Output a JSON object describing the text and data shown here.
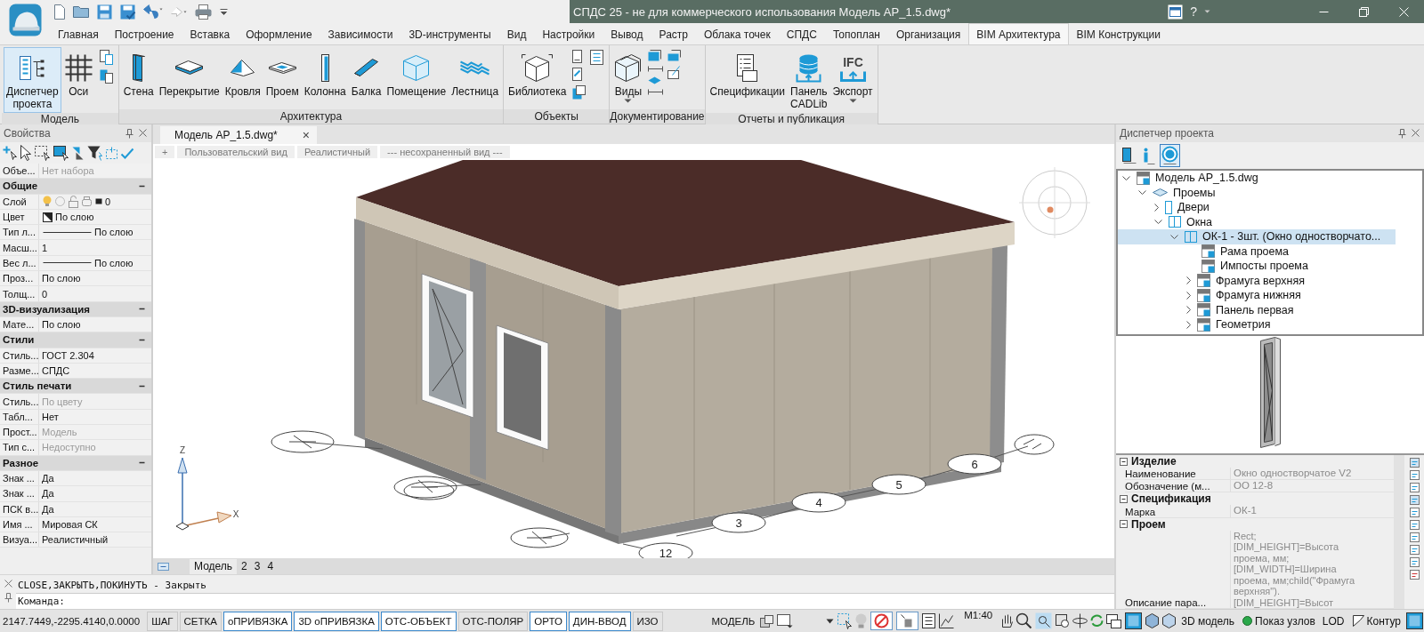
{
  "title_bar": {
    "title": "СПДС 25 - не для коммерческого использования Модель АР_1.5.dwg*",
    "help": "?"
  },
  "menu_tabs": [
    {
      "label": "Главная",
      "selected": false
    },
    {
      "label": "Построение",
      "selected": false
    },
    {
      "label": "Вставка",
      "selected": false
    },
    {
      "label": "Оформление",
      "selected": false
    },
    {
      "label": "Зависимости",
      "selected": false
    },
    {
      "label": "3D-инструменты",
      "selected": false
    },
    {
      "label": "Вид",
      "selected": false
    },
    {
      "label": "Настройки",
      "selected": false
    },
    {
      "label": "Вывод",
      "selected": false
    },
    {
      "label": "Растр",
      "selected": false
    },
    {
      "label": "Облака точек",
      "selected": false
    },
    {
      "label": "СПДС",
      "selected": false
    },
    {
      "label": "Топоплан",
      "selected": false
    },
    {
      "label": "Организация",
      "selected": false
    },
    {
      "label": "BIM Архитектура",
      "selected": true
    },
    {
      "label": "BIM Конструкции",
      "selected": false
    }
  ],
  "ribbon": {
    "groups": [
      {
        "label": "Модель",
        "buttons": [
          {
            "label": "Диспетчер проекта",
            "selected": true
          },
          {
            "label": "Оси",
            "selected": false
          }
        ]
      },
      {
        "label": "Архитектура",
        "buttons": [
          {
            "label": "Стена",
            "selected": false
          },
          {
            "label": "Перекрытие",
            "selected": false
          },
          {
            "label": "Кровля",
            "selected": false
          },
          {
            "label": "Проем",
            "selected": false
          },
          {
            "label": "Колонна",
            "selected": false
          },
          {
            "label": "Балка",
            "selected": false
          },
          {
            "label": "Помещение",
            "selected": false
          },
          {
            "label": "Лестница",
            "selected": false
          }
        ]
      },
      {
        "label": "Объекты",
        "buttons": [
          {
            "label": "Библиотека",
            "selected": false
          }
        ]
      },
      {
        "label": "Документирование",
        "buttons": [
          {
            "label": "Виды",
            "selected": false
          }
        ]
      },
      {
        "label": "Отчеты и публикация",
        "buttons": [
          {
            "label": "Спецификации",
            "selected": false
          },
          {
            "label": "Панель CADLib",
            "selected": false
          },
          {
            "label": "Экспорт",
            "selected": false,
            "icon_text": "IFC"
          }
        ]
      }
    ]
  },
  "properties_panel": {
    "title": "Свойства",
    "rows": [
      {
        "kind": "row",
        "label": "Объе...",
        "value": "Нет набора",
        "disabled": true
      },
      {
        "kind": "category",
        "label": "Общие",
        "expanded": true
      },
      {
        "kind": "layer",
        "label": "Слой",
        "value": "0",
        "disabled": false
      },
      {
        "kind": "color",
        "label": "Цвет",
        "value": "По слою",
        "disabled": false
      },
      {
        "kind": "line",
        "label": "Тип л...",
        "value": "По слою",
        "disabled": false
      },
      {
        "kind": "row",
        "label": "Масш...",
        "value": "1",
        "disabled": false
      },
      {
        "kind": "line",
        "label": "Вес л...",
        "value": "По слою",
        "disabled": false
      },
      {
        "kind": "row",
        "label": "Проз...",
        "value": "По слою",
        "disabled": false
      },
      {
        "kind": "row",
        "label": "Толщ...",
        "value": "0",
        "disabled": false
      },
      {
        "kind": "category",
        "label": "3D-визуализация",
        "expanded": true
      },
      {
        "kind": "row",
        "label": "Мате...",
        "value": "По слою",
        "disabled": false
      },
      {
        "kind": "category",
        "label": "Стили",
        "expanded": true
      },
      {
        "kind": "row",
        "label": "Стиль...",
        "value": "ГОСТ 2.304",
        "disabled": false
      },
      {
        "kind": "row",
        "label": "Разме...",
        "value": "СПДС",
        "disabled": false
      },
      {
        "kind": "category",
        "label": "Стиль печати",
        "expanded": true
      },
      {
        "kind": "row",
        "label": "Стиль...",
        "value": "По цвету",
        "disabled": true
      },
      {
        "kind": "row",
        "label": "Табл...",
        "value": "Нет",
        "disabled": false
      },
      {
        "kind": "row",
        "label": "Прост...",
        "value": "Модель",
        "disabled": true
      },
      {
        "kind": "row",
        "label": "Тип с...",
        "value": "Недоступно",
        "disabled": true
      },
      {
        "kind": "category",
        "label": "Разное",
        "expanded": true
      },
      {
        "kind": "row",
        "label": "Знак ...",
        "value": "Да",
        "disabled": false
      },
      {
        "kind": "row",
        "label": "Знак ...",
        "value": "Да",
        "disabled": false
      },
      {
        "kind": "row",
        "label": "ПСК в...",
        "value": "Да",
        "disabled": false
      },
      {
        "kind": "row",
        "label": "Имя ...",
        "value": "Мировая СК",
        "disabled": false
      },
      {
        "kind": "row",
        "label": "Визуа...",
        "value": "Реалистичный",
        "disabled": false
      }
    ]
  },
  "viewport": {
    "document_tab": {
      "label": "Модель АР_1.5.dwg*",
      "close": "×"
    },
    "view_controls": [
      "+",
      "Пользовательский вид",
      "Реалистичный",
      "--- несохраненный вид ---"
    ],
    "axis_labels": {
      "z": "Z",
      "x": "X"
    },
    "grid_marks": [
      "12",
      "3",
      "4",
      "5",
      "6"
    ],
    "layout_tabs": [
      {
        "label": "Модель",
        "selected": true
      },
      {
        "label": "2",
        "selected": false
      },
      {
        "label": "3",
        "selected": false
      },
      {
        "label": "4",
        "selected": false
      }
    ]
  },
  "command_line": {
    "history": "CLOSE,ЗАКРЫТЬ,ПОКИНУТЬ - Закрыть",
    "prompt": "Команда:"
  },
  "project_manager": {
    "title": "Диспетчер проекта",
    "view_buttons": [
      {
        "selected": false
      },
      {
        "selected": false
      },
      {
        "selected": true
      }
    ],
    "tree": [
      {
        "label": "Модель АР_1.5.dwg",
        "kind": "dwg",
        "expanded": true,
        "selected": false,
        "children": [
          {
            "label": "Проемы",
            "kind": "group",
            "expanded": true,
            "selected": false,
            "children": [
              {
                "label": "Двери",
                "kind": "door",
                "expanded": false,
                "selected": false
              },
              {
                "label": "Окна",
                "kind": "window",
                "expanded": true,
                "selected": false,
                "children": [
                  {
                    "label": "ОК-1 - 3шт. (Окно одностворчато...",
                    "kind": "window",
                    "expanded": true,
                    "selected": true,
                    "children": [
                      {
                        "label": "Рама проема",
                        "kind": "dwg",
                        "selected": false
                      },
                      {
                        "label": "Импосты проема",
                        "kind": "dwg",
                        "selected": false
                      },
                      {
                        "label": "Фрамуга верхняя",
                        "kind": "dwg",
                        "expanded": false,
                        "selected": false
                      },
                      {
                        "label": "Фрамуга нижняя",
                        "kind": "dwg",
                        "expanded": false,
                        "selected": false
                      },
                      {
                        "label": "Панель первая",
                        "kind": "dwg",
                        "expanded": false,
                        "selected": false
                      },
                      {
                        "label": "Геометрия",
                        "kind": "dwg",
                        "expanded": false,
                        "selected": false
                      }
                    ]
                  }
                ]
              }
            ]
          }
        ]
      }
    ],
    "properties": [
      {
        "kind": "category",
        "label": "Изделие",
        "expanded": true
      },
      {
        "kind": "row",
        "label": "Наименование",
        "value": "Окно одностворчатое V2"
      },
      {
        "kind": "row",
        "label": "Обозначение (м...",
        "value": "ОО 12-8"
      },
      {
        "kind": "category",
        "label": "Спецификация",
        "expanded": true
      },
      {
        "kind": "row",
        "label": "Марка",
        "value": "ОК-1"
      },
      {
        "kind": "category",
        "label": "Проем",
        "expanded": true
      },
      {
        "kind": "long",
        "label": "Описание пара...",
        "value": "Rect;[DIM_HEIGHT]=Высота проема, мм;[DIM_WIDTH]=Ширина проема, мм;child(\"Фрамуга верхняя\").[DIM_HEIGHT]=Высот"
      }
    ]
  },
  "status_bar": {
    "coordinates": "2147.7449,-2295.4140,0.0000",
    "toggles": [
      {
        "label": "ШАГ",
        "on": false
      },
      {
        "label": "СЕТКА",
        "on": false
      },
      {
        "label": "оПРИВЯЗКА",
        "on": true
      },
      {
        "label": "3D оПРИВЯЗКА",
        "on": true
      },
      {
        "label": "ОТС-ОБЪЕКТ",
        "on": true
      },
      {
        "label": "ОТС-ПОЛЯР",
        "on": false
      },
      {
        "label": "ОРТО",
        "on": true
      },
      {
        "label": "ДИН-ВВОД",
        "on": true
      },
      {
        "label": "ИЗО",
        "on": false
      }
    ],
    "space": "МОДЕЛЬ",
    "scale": "М1:40",
    "tools": [
      {
        "kind": "model",
        "label": "3D модель"
      },
      {
        "kind": "nodes",
        "label": "Показ узлов"
      },
      {
        "kind": "plain",
        "label": "LOD"
      },
      {
        "kind": "contour",
        "label": "Контур"
      }
    ]
  }
}
